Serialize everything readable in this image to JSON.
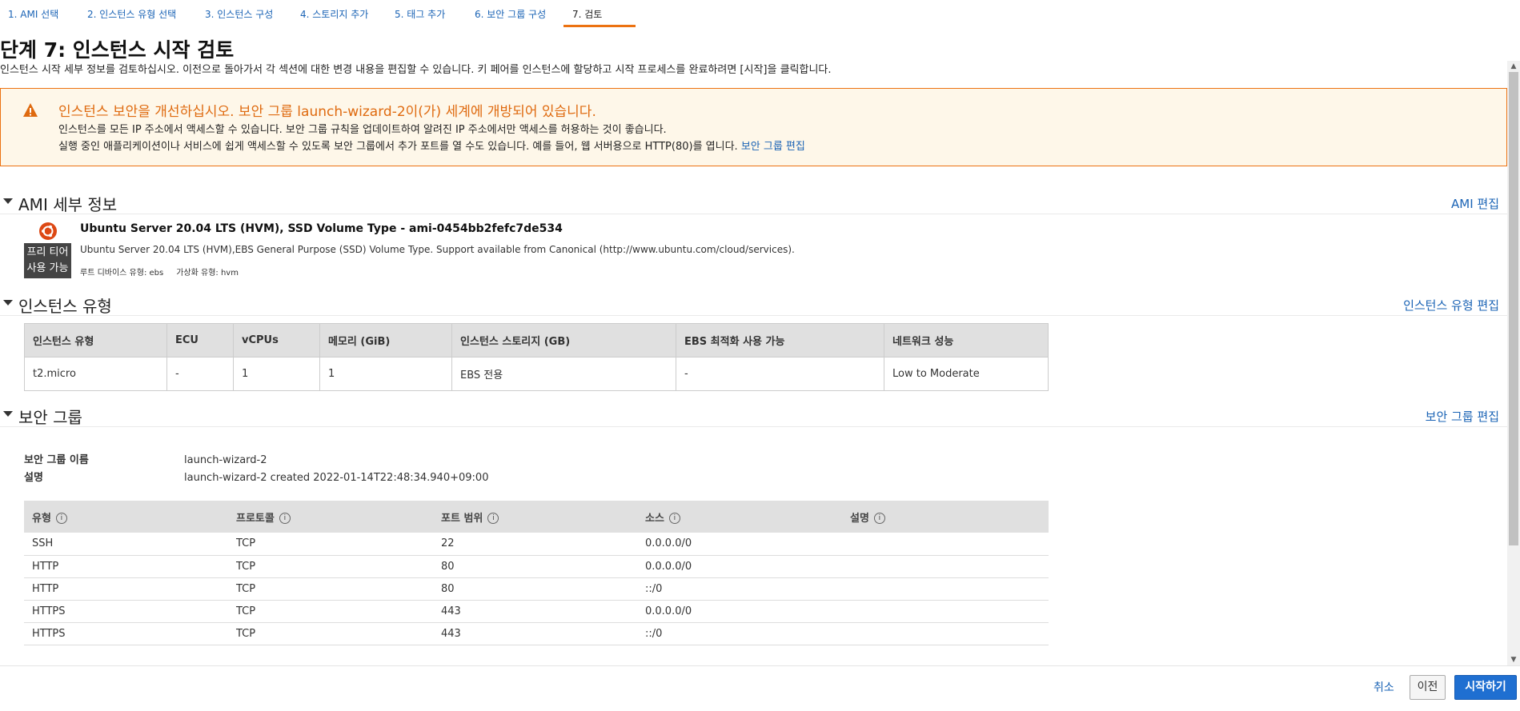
{
  "wizard": {
    "steps": [
      {
        "label": "1. AMI 선택"
      },
      {
        "label": "2. 인스턴스 유형 선택"
      },
      {
        "label": "3. 인스턴스 구성"
      },
      {
        "label": "4. 스토리지 추가"
      },
      {
        "label": "5. 태그 추가"
      },
      {
        "label": "6. 보안 그룹 구성"
      },
      {
        "label": "7. 검토"
      }
    ],
    "active_step": 7
  },
  "page": {
    "title": "단계 7: 인스턴스 시작 검토",
    "description": "인스턴스 시작 세부 정보를 검토하십시오. 이전으로 돌아가서 각 섹션에 대한 변경 내용을 편집할 수 있습니다. 키 페어를 인스턴스에 할당하고 시작 프로세스를 완료하려면 [시작]을 클릭합니다."
  },
  "warning": {
    "icon": "warning-triangle-icon",
    "title": "인스턴스 보안을 개선하십시오. 보안 그룹 launch-wizard-2이(가) 세계에 개방되어 있습니다.",
    "line1": "인스턴스를 모든 IP 주소에서 액세스할 수 있습니다. 보안 그룹 규칙을 업데이트하여 알려진 IP 주소에서만 액세스를 허용하는 것이 좋습니다.",
    "line2": "실행 중인 애플리케이션이나 서비스에 쉽게 액세스할 수 있도록 보안 그룹에서 추가 포트를 열 수도 있습니다. 예를 들어, 웹 서버용으로 HTTP(80)를 엽니다.",
    "link": "보안 그룹 편집"
  },
  "ami": {
    "section_title": "AMI 세부 정보",
    "edit_label": "AMI 편집",
    "logo_icon": "ubuntu-logo-icon",
    "free_tier_line1": "프리 티어",
    "free_tier_line2": "사용 가능",
    "name": "Ubuntu Server 20.04 LTS (HVM), SSD Volume Type - ami-0454bb2fefc7de534",
    "description": "Ubuntu Server 20.04 LTS (HVM),EBS General Purpose (SSD) Volume Type. Support available from Canonical (http://www.ubuntu.com/cloud/services).",
    "root_device": "루트 디바이스 유형: ebs",
    "virtualization": "가상화 유형: hvm"
  },
  "instance_type": {
    "section_title": "인스턴스 유형",
    "edit_label": "인스턴스 유형 편집",
    "headers": [
      "인스턴스 유형",
      "ECU",
      "vCPUs",
      "메모리 (GiB)",
      "인스턴스 스토리지 (GB)",
      "EBS 최적화 사용 가능",
      "네트워크 성능"
    ],
    "row": [
      "t2.micro",
      "-",
      "1",
      "1",
      "EBS 전용",
      "-",
      "Low to Moderate"
    ]
  },
  "security_group": {
    "section_title": "보안 그룹",
    "edit_label": "보안 그룹 편집",
    "name_label": "보안 그룹 이름",
    "name_value": "launch-wizard-2",
    "desc_label": "설명",
    "desc_value": "launch-wizard-2 created 2022-01-14T22:48:34.940+09:00",
    "headers": [
      "유형",
      "프로토콜",
      "포트 범위",
      "소스",
      "설명"
    ],
    "info_icon": "i",
    "rules": [
      {
        "type": "SSH",
        "protocol": "TCP",
        "port": "22",
        "source": "0.0.0.0/0",
        "desc": ""
      },
      {
        "type": "HTTP",
        "protocol": "TCP",
        "port": "80",
        "source": "0.0.0.0/0",
        "desc": ""
      },
      {
        "type": "HTTP",
        "protocol": "TCP",
        "port": "80",
        "source": "::/0",
        "desc": ""
      },
      {
        "type": "HTTPS",
        "protocol": "TCP",
        "port": "443",
        "source": "0.0.0.0/0",
        "desc": ""
      },
      {
        "type": "HTTPS",
        "protocol": "TCP",
        "port": "443",
        "source": "::/0",
        "desc": ""
      }
    ]
  },
  "footer": {
    "cancel_label": "취소",
    "prev_label": "이전",
    "launch_label": "시작하기"
  },
  "colors": {
    "link": "#1a63b5",
    "warning_border": "#ec7211",
    "warning_bg": "#fef7e9",
    "primary_button": "#1f6fd1"
  }
}
